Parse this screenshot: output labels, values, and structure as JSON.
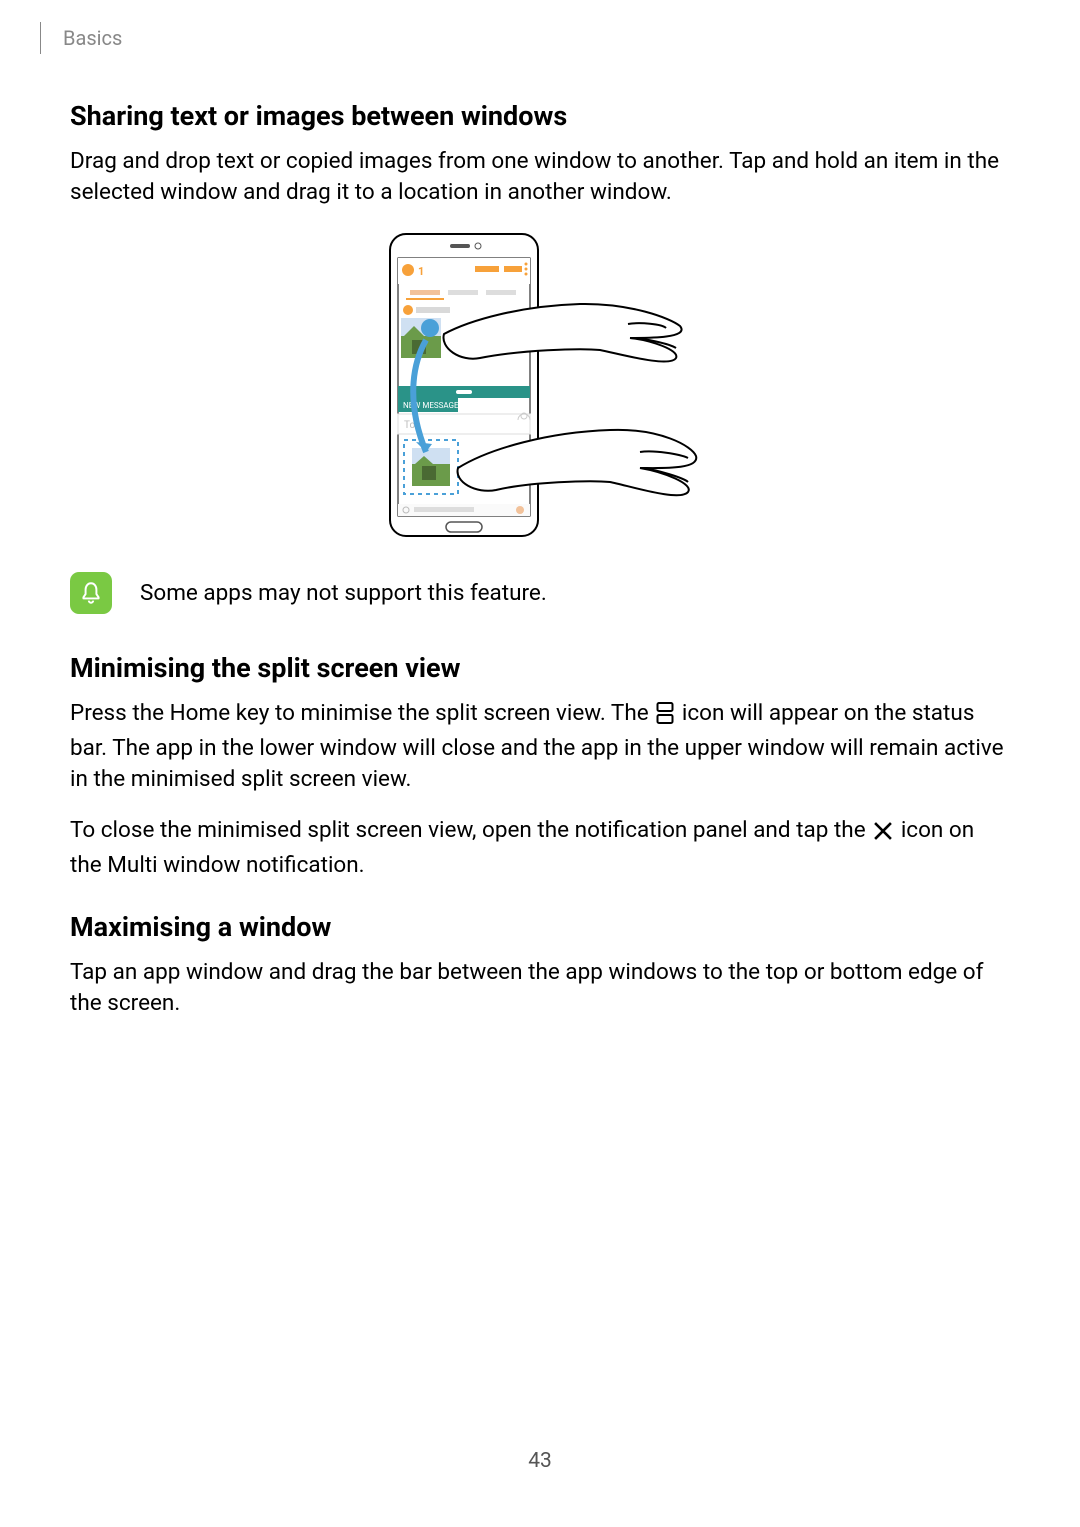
{
  "breadcrumb": "Basics",
  "section1": {
    "heading": "Sharing text or images between windows",
    "body": "Drag and drop text or copied images from one window to another. Tap and hold an item in the selected window and drag it to a location in another window."
  },
  "note": {
    "text": "Some apps may not support this feature."
  },
  "section2": {
    "heading": "Minimising the split screen view",
    "p1a": "Press the Home key to minimise the split screen view. The",
    "p1b": "icon will appear on the status bar. The app in the lower window will close and the app in the upper window will remain active in the minimised split screen view.",
    "p2a": "To close the minimised split screen view, open the notification panel and tap the",
    "p2b": "icon on the Multi window notification."
  },
  "section3": {
    "heading": "Maximising a window",
    "body": "Tap an app window and drag the bar between the app windows to the top or bottom edge of the screen."
  },
  "page_number": "43"
}
